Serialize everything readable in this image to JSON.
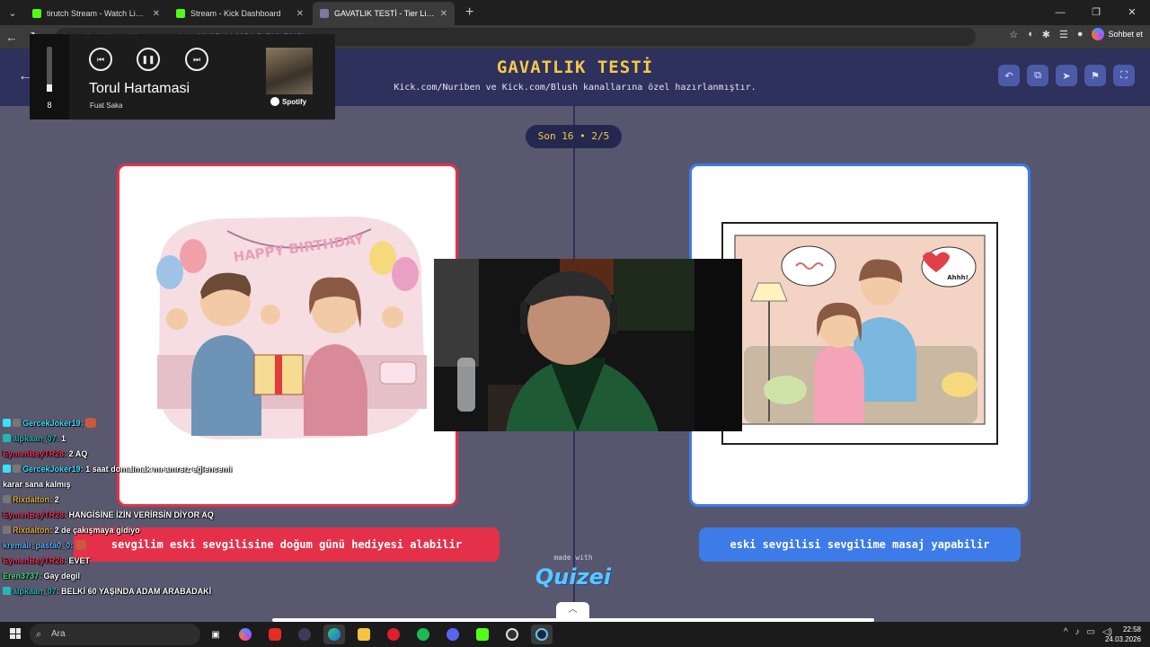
{
  "browser": {
    "tabs": [
      {
        "label": "tirutch Stream - Watch Live on Kic",
        "favicon_color": "#53fc18"
      },
      {
        "label": "Stream - Kick Dashboard",
        "favicon_color": "#53fc18"
      },
      {
        "label": "GAVATLIK TESTİ - Tier List, Kör Sıra",
        "favicon_color": "#7a7aa0"
      }
    ],
    "url": "https://quizei.com/tr/tournament/quiz/68d371fcb9254c5e709c7867/play",
    "copilot_label": "Sohbet et"
  },
  "quiz": {
    "title": "GAVATLIK TESTİ",
    "subtitle": "Kick.com/Nuriben ve Kick.com/Blush kanallarına özel hazırlanmıştır.",
    "round": "Son 16 • 2/5",
    "left_caption": "sevgilim eski sevgilisine doğum günü hediyesi alabilir",
    "right_caption": "eski sevgilisi sevgilime masaj yapabilir",
    "left_banner": "HAPPY BIRTHDAY",
    "right_bubble": "Ahhh!",
    "made_with": "made with",
    "brand": "Quizei",
    "colors": {
      "left_accent": "#e5304a",
      "right_accent": "#3d7be8",
      "title": "#f7c948"
    }
  },
  "spotify": {
    "song": "Torul Hartamasi",
    "artist": "Fuat Saka",
    "volume": "8",
    "brand": "Spotify"
  },
  "chat": [
    {
      "user": "GercekJoker19:",
      "msg": "",
      "color": "#3ae0ff",
      "emote": true
    },
    {
      "user": "alpkaan_07:",
      "msg": "1",
      "color": "#22b8b8"
    },
    {
      "user": "EymenBeyTR28:",
      "msg": "2 AQ",
      "color": "#e8335a"
    },
    {
      "user": "GercekJoker19:",
      "msg": "1 saat domalmak mı amrsız eğlencemi",
      "color": "#3ae0ff"
    },
    {
      "user": "",
      "msg": "karar sana kalmış",
      "color": "#ffffff"
    },
    {
      "user": "Rixdalton:",
      "msg": "2",
      "color": "#e0b040"
    },
    {
      "user": "EymenBeyTR28:",
      "msg": "HANGİSİNE İZİN VERİRSİN DİYOR AQ",
      "color": "#e8335a"
    },
    {
      "user": "Rixdalton:",
      "msg": "2 de çakışmaya gidiyo",
      "color": "#e0b040"
    },
    {
      "user": "kremali_pasta0_0:",
      "msg": "",
      "color": "#5ab0ff"
    },
    {
      "user": "EymenBeyTR28:",
      "msg": "EVET",
      "color": "#e8335a"
    },
    {
      "user": "Eren3737:",
      "msg": "Gay degil",
      "color": "#3ae07a"
    },
    {
      "user": "alpkaan_07:",
      "msg": "BELKİ 60 YAŞINDA ADAM ARABADAKİ",
      "color": "#22b8b8"
    }
  ],
  "taskbar": {
    "search_placeholder": "Ara",
    "time": "22:58",
    "date": "24.03.2026"
  }
}
